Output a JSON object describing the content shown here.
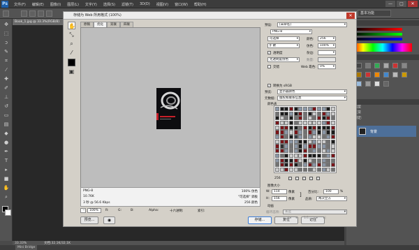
{
  "app": {
    "logo": "Ps"
  },
  "menubar": {
    "items": [
      "文件(F)",
      "编辑(E)",
      "图像(I)",
      "图层(L)",
      "文字(Y)",
      "选择(S)",
      "滤镜(T)",
      "3D(D)",
      "视图(V)",
      "窗口(W)",
      "帮助(H)"
    ]
  },
  "window_controls": {
    "minimize": "—",
    "maximize": "□",
    "close": "✕"
  },
  "workspace": {
    "label": "基本功能"
  },
  "document_tab": {
    "label": "Book_1.jpg @ 33.3%(RGB/8)"
  },
  "statusbar": {
    "zoom": "33.33%",
    "doc": "文档:32.1K/32.1K",
    "mini_bridge": "Mini Bridge"
  },
  "right_panels": {
    "swatch_tab": "样式",
    "layers_rows": [
      "类型",
      "正常",
      "锁定:"
    ],
    "layer_name": "背景",
    "opacity_label": "不透明度:",
    "fill_label": "填充:"
  },
  "dialog": {
    "title": "存储为 Web 所用格式 (100%)",
    "close": "✕",
    "preview_tabs": [
      "原稿",
      "优化",
      "双联",
      "四联"
    ],
    "active_tab_index": 1,
    "info": {
      "format": "PNG-8",
      "size": "10.76K",
      "time": "3 秒 @ 56.6 Kbps",
      "quality": "100% 仿色",
      "palette": "\"可选择\" 调板",
      "colors": "256 颜色"
    },
    "zoom": "100%",
    "readouts": {
      "r": "R:",
      "g": "G:",
      "b": "B:",
      "alpha": "Alpha:",
      "hex": "十六进制:",
      "index": "索引:"
    },
    "buttons": {
      "preview": "预览...",
      "save": "存储...",
      "cancel": "复位",
      "done": "记住"
    },
    "settings": {
      "preset_label": "预设:",
      "preset_value": "[未命名]",
      "format": "PNG-8",
      "reduction": "可选择",
      "colors_label": "颜色:",
      "colors_value": "256",
      "dither_algo": "扩散",
      "dither_label": "仿色:",
      "dither_value": "100%",
      "transparency_label": "透明度",
      "matte_label": "杂边:",
      "transparency_dither": "无透明度仿色",
      "amount_label": "数量:",
      "interlaced_label": "交错",
      "web_snap_label": "Web 靠色:",
      "web_snap_value": "0%",
      "convert_srgb_label": "转换为 sRGB",
      "preview_label": "预览:",
      "preview_value": "显示器颜色",
      "metadata_label": "元数据:",
      "metadata_value": "版权和联系信息",
      "color_table_label": "颜色表",
      "color_count": "256",
      "image_size_label": "图像大小",
      "w_label": "W:",
      "w_value": "114",
      "h_label": "H:",
      "h_value": "156",
      "px_unit": "像素",
      "percent_label": "百分比:",
      "percent_value": "100",
      "percent_unit": "%",
      "quality_label": "品质:",
      "quality_value": "两次立方",
      "animation_label": "动画",
      "loop_label": "循环选项:",
      "loop_value": "永远",
      "frame_counter": "1/1"
    }
  },
  "colors": {
    "accent": "#1e5ea8",
    "red_swatch": "#c8202a"
  }
}
